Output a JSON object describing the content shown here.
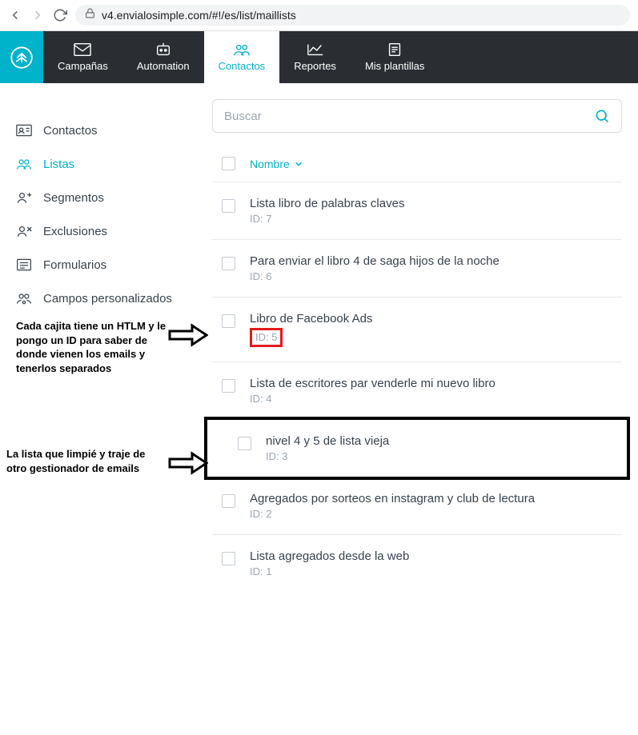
{
  "browser": {
    "url": "v4.envialosimple.com/#!/es/list/maillists"
  },
  "nav": {
    "items": [
      {
        "label": "Campañas"
      },
      {
        "label": "Automation"
      },
      {
        "label": "Contactos"
      },
      {
        "label": "Reportes"
      },
      {
        "label": "Mis plantillas"
      }
    ]
  },
  "sidebar": {
    "items": [
      {
        "label": "Contactos"
      },
      {
        "label": "Listas"
      },
      {
        "label": "Segmentos"
      },
      {
        "label": "Exclusiones"
      },
      {
        "label": "Formularios"
      },
      {
        "label": "Campos personalizados"
      }
    ]
  },
  "search": {
    "placeholder": "Buscar"
  },
  "table": {
    "name_col": "Nombre"
  },
  "rows": [
    {
      "title": "Lista libro de palabras claves",
      "sub": "ID: 7"
    },
    {
      "title": "Para enviar el libro 4 de saga hijos de la noche",
      "sub": "ID: 6"
    },
    {
      "title": "Libro de Facebook Ads",
      "sub": "ID: 5"
    },
    {
      "title": "Lista de escritores par venderle mi nuevo libro",
      "sub": "ID: 4"
    },
    {
      "title": "nivel 4 y 5 de lista vieja",
      "sub": "ID: 3"
    },
    {
      "title": "Agregados por sorteos en instagram y club de lectura",
      "sub": "ID: 2"
    },
    {
      "title": "Lista agregados desde la web",
      "sub": "ID: 1"
    }
  ],
  "annotations": {
    "a1": "Cada cajita tiene un HTLM y le pongo un ID para saber de donde vienen los emails y tenerlos separados",
    "a2": "La lista que limpié y traje de otro gestionador de emails"
  }
}
